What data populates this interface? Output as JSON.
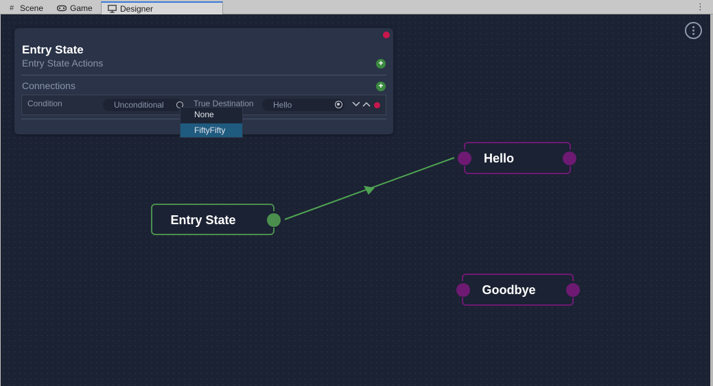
{
  "tabs": [
    {
      "label": "Scene",
      "icon": "grid-icon"
    },
    {
      "label": "Game",
      "icon": "gamepad-icon"
    },
    {
      "label": "Designer",
      "icon": "monitor-icon",
      "active": true
    }
  ],
  "panel": {
    "title": "Entry State",
    "actions_label": "Entry State Actions",
    "connections_label": "Connections",
    "connection": {
      "condition_label": "Condition",
      "condition_value": "Unconditional",
      "true_destination_label": "True Destination",
      "true_destination_value": "Hello"
    }
  },
  "dropdown": {
    "options": [
      "None",
      "FiftyFifty"
    ],
    "selected": "FiftyFifty"
  },
  "nodes": {
    "entry": {
      "label": "Entry State"
    },
    "hello": {
      "label": "Hello"
    },
    "goodbye": {
      "label": "Goodbye"
    }
  },
  "colors": {
    "canvas": "#1b2233",
    "panel": "#2a3348",
    "entry_green": "#4b8f4e",
    "state_purple": "#6e1a73",
    "delete_red": "#c8174d",
    "connection_line": "#4fa352"
  }
}
